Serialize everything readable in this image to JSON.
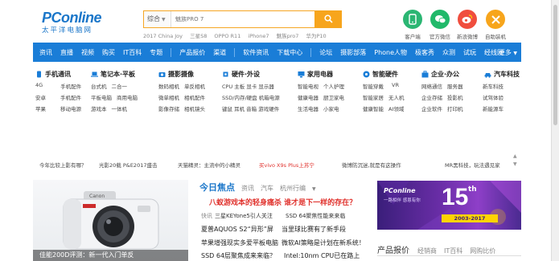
{
  "header": {
    "brand": "PConline",
    "brand_sub": "太平洋电脑网",
    "search": {
      "category": "综合",
      "placeholder": "魅族PRO 7",
      "hotwords": [
        "2017 China Joy",
        "三星S8",
        "OPPO R11",
        "iPhone7",
        "魅族pro7",
        "华为P10"
      ]
    },
    "quick_links": [
      {
        "label": "客户端",
        "icon": "phone-icon",
        "color": "#29b36f"
      },
      {
        "label": "官方微信",
        "icon": "wechat-icon",
        "color": "#21b96a"
      },
      {
        "label": "新浪微博",
        "icon": "weibo-icon",
        "color": "#f04e3e"
      },
      {
        "label": "自助装机",
        "icon": "tools-icon",
        "color": "#f7a51c"
      }
    ]
  },
  "nav": {
    "items": [
      "资讯",
      "直播",
      "视频",
      "购买",
      "IT百科",
      "专题",
      "|",
      "产品报价",
      "渠道",
      "|",
      "软件资讯",
      "下载中心",
      "|",
      "论坛",
      "摄影部落",
      "Phone人物",
      "极客秀",
      "众测",
      "试玩",
      "经线网"
    ],
    "more": "更多"
  },
  "categories": [
    {
      "title": "手机通讯",
      "icon": "mobile-icon",
      "rows": [
        [
          "4G",
          "手机配件"
        ],
        [
          "安卓",
          "手机配件"
        ],
        [
          "苹果",
          "移动电源"
        ]
      ]
    },
    {
      "title": "笔记本·平板",
      "icon": "laptop-icon",
      "rows": [
        [
          "台式机",
          "二合一"
        ],
        [
          "平板电脑",
          "商用电脑"
        ],
        [
          "游戏本",
          "一体机"
        ]
      ]
    },
    {
      "title": "摄影摄像",
      "icon": "camera-icon",
      "rows": [
        [
          "数码相机",
          "单反相机"
        ],
        [
          "微单相机",
          "相机配件"
        ],
        [
          "影像存储",
          "相机镜头"
        ]
      ]
    },
    {
      "title": "硬件·外设",
      "icon": "chip-icon",
      "rows": [
        [
          "CPU 主板 显卡 显示器"
        ],
        [
          "SSD/内存/硬盘 机箱电源"
        ],
        [
          "键鼠 耳机 音箱 游戏硬件"
        ]
      ]
    },
    {
      "title": "家用电器",
      "icon": "appliance-icon",
      "rows": [
        [
          "智能电视",
          "个人护理"
        ],
        [
          "健康电器",
          "厨卫家电"
        ],
        [
          "生活电器",
          "小家电"
        ]
      ]
    },
    {
      "title": "智能硬件",
      "icon": "smart-icon",
      "rows": [
        [
          "智能穿戴",
          "VR"
        ],
        [
          "智能家居",
          "无人机"
        ],
        [
          "健康智能",
          "AI领域"
        ]
      ]
    },
    {
      "title": "企业·办公",
      "icon": "office-icon",
      "rows": [
        [
          "网络通信",
          "服务器"
        ],
        [
          "企业存储",
          "投影机"
        ],
        [
          "企业软件",
          "打印机"
        ]
      ]
    },
    {
      "title": "汽车科技",
      "icon": "car-icon",
      "rows": [
        [
          "新车科技"
        ],
        [
          "试驾体验"
        ],
        [
          "新能源车"
        ]
      ]
    }
  ],
  "ticker": [
    {
      "text": "今年比较上影有哪？",
      "red": false
    },
    {
      "text": "光影20载 P&E2017盛击",
      "red": false
    },
    {
      "text": "天猫精灵：主流中的小精灵",
      "red": false
    },
    {
      "text": "买vivo X9s Plus上苏宁",
      "red": true
    },
    {
      "text": "微博防沉迷,就是有这操作",
      "red": false
    },
    {
      "text": "MR黑科技，玩法遇见家",
      "red": false
    }
  ],
  "feature_caption": "佳能200D评测：新一代入门单反",
  "focus": {
    "title": "今日焦点",
    "tabs": [
      "资讯",
      "汽车",
      "杭州行编"
    ],
    "headline": "八蚁游戏本的轻身痛杀  谁才是下一样的存在？",
    "news": [
      {
        "tag": "快讯",
        "text": "三星KEYone5引人关注"
      },
      {
        "tag": "",
        "text": "SSD 64聚焦性能来来临"
      },
      {
        "tag": "",
        "text": "夏普AQUOS S2“异形”屏"
      },
      {
        "tag": "",
        "text": "当里球比赛有了新手段"
      },
      {
        "tag": "",
        "text": "苹果增强现实多爱平板电脑"
      },
      {
        "tag": "",
        "text": "微软AI策略是计划在新系统！"
      },
      {
        "tag": "",
        "text": "SSD 64层聚焦成来来临？"
      },
      {
        "tag": "",
        "text": "Intel:10nm CPU已在路上"
      }
    ]
  },
  "banner": {
    "logo": "PConline",
    "slogan": "一路相伴 感恩有你",
    "number": "15",
    "suffix": "th",
    "years": "2003-2017"
  },
  "products": {
    "title": "产品报价",
    "tabs": [
      "经销商",
      "IT百科",
      "网购比价"
    ]
  }
}
